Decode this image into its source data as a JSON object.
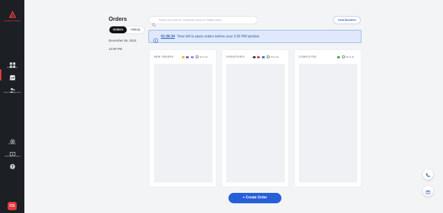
{
  "sidebar": {
    "brand": "FARMDOOMER",
    "items": [
      {
        "label": "Dashboard",
        "icon": "grid-icon"
      },
      {
        "label": "Orders",
        "icon": "orders-icon"
      },
      {
        "label": "User Management",
        "icon": "users-icon"
      },
      {
        "label": "Settings",
        "icon": "gear-icon"
      },
      {
        "label": "Training Content",
        "icon": "video-icon"
      },
      {
        "label": "FAQ",
        "icon": "help-icon"
      }
    ],
    "active_item": "Orders",
    "avatar_initials": "CG"
  },
  "page": {
    "title": "Orders",
    "tabs": [
      "Orders",
      "History"
    ],
    "active_tab": "Orders",
    "date": "December 05, 2023",
    "time": "12:50 PM"
  },
  "search": {
    "placeholder": "Search by Order ID, Customer name or Facility name...",
    "value": ""
  },
  "view_bundles_label": "View Bundles",
  "banner": {
    "countdown": "01:36:34",
    "message": "Time left to place orders before your 3:00 PM window"
  },
  "columns": [
    {
      "title": "NEW ORDERS",
      "legend_colors": [
        "#f2b233",
        "#6a5ae0",
        "#6a5ae0"
      ],
      "show_all_label": "Show all"
    },
    {
      "title": "DISPATCHED",
      "legend_colors": [
        "#4a3a2a",
        "#e23b3b",
        "#3a6fd8"
      ],
      "show_all_label": "Show all"
    },
    {
      "title": "COMPLETED",
      "legend_colors": [
        "#3aaa4a"
      ],
      "show_all_label": "Show all"
    }
  ],
  "create_order_label": "+ Create Order",
  "colors": {
    "sidebar_bg": "#1c1f24",
    "accent_red": "#e23b3b",
    "primary_blue": "#2560d8",
    "banner_bg": "#dfe9fb"
  }
}
